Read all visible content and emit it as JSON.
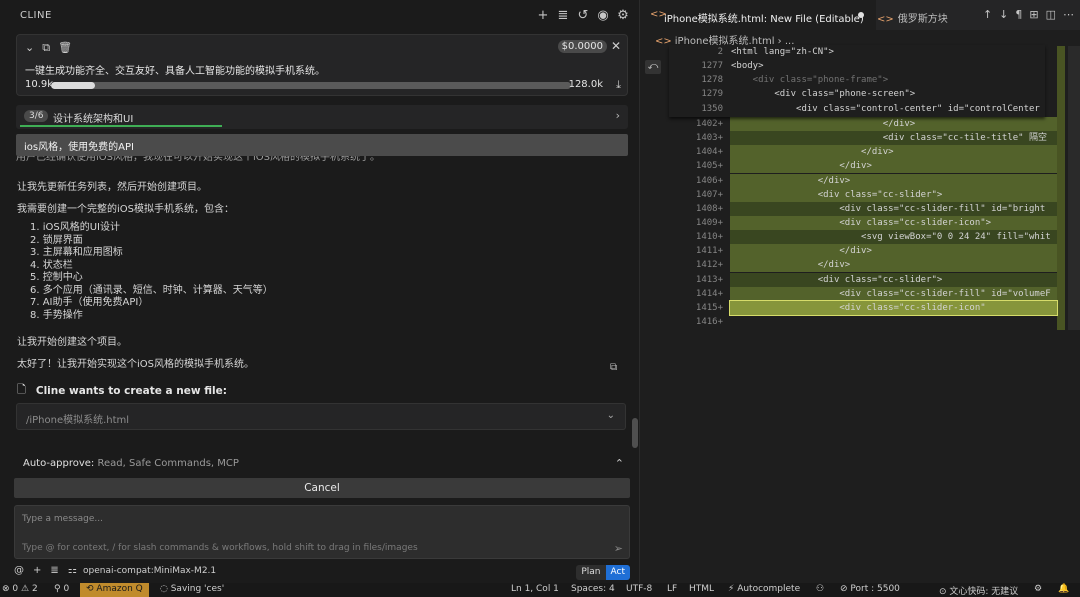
{
  "cline": {
    "title": "CLINE",
    "header_icons": [
      "+",
      "≣",
      "↺",
      "◉",
      "⚙"
    ],
    "task": {
      "cost": "$0.0000",
      "text": "一键生成功能齐全、交互友好、具备人工智能功能的模拟手机系统。",
      "context_used": "10.9k",
      "context_max": "128.0k",
      "context_fraction": 0.085
    },
    "step": {
      "badge": "3/6",
      "label": "设计系统架构和UI",
      "progress_fraction": 0.33
    },
    "tooltip": "ios风格，使用免费的API",
    "cut_line": "用户已经确认使用iOS风格，我现在可以开始实现这个iOS风格的模拟手机系统了。",
    "messages": {
      "m1": "让我先更新任务列表，然后开始创建项目。",
      "m2": "我需要创建一个完整的iOS模拟手机系统，包含：",
      "list": [
        "1. iOS风格的UI设计",
        "2. 锁屏界面",
        "3. 主屏幕和应用图标",
        "4. 状态栏",
        "5. 控制中心",
        "6. 多个应用（通讯录、短信、时钟、计算器、天气等）",
        "7. AI助手（使用免费API）",
        "8. 手势操作"
      ],
      "m3": "让我开始创建这个项目。",
      "m4": "太好了！让我开始实现这个iOS风格的模拟手机系统。"
    },
    "create": {
      "title": "Cline wants to create a new file:",
      "file": "/iPhone模拟系统.html"
    },
    "auto_approve": {
      "label": "Auto-approve:",
      "value": "Read, Safe Commands, MCP"
    },
    "cancel_label": "Cancel",
    "input": {
      "placeholder": "Type a message...",
      "hint": "Type @ for context, / for slash commands & workflows, hold shift to drag in files/images"
    },
    "footer": {
      "model": "openai-compat:MiniMax-M2.1",
      "plan": "Plan",
      "act": "Act"
    }
  },
  "editor": {
    "tab_active": "iPhone模拟系统.html: New File (Editable)",
    "tab2": "俄罗斯方块",
    "breadcrumb": "iPhone模拟系统.html",
    "breadcrumb_more": "...",
    "sticky": [
      {
        "ln": "2",
        "code": "<html lang=\"zh-CN\">"
      },
      {
        "ln": "1277",
        "code": "<body>"
      },
      {
        "ln": "1278",
        "code": "    <div class=\"phone-frame\">"
      },
      {
        "ln": "1279",
        "code": "        <div class=\"phone-screen\">"
      },
      {
        "ln": "1350",
        "code": "            <div class=\"control-center\" id=\"controlCenter"
      }
    ],
    "lines": [
      {
        "ln": "1402+",
        "code": "                            </div>"
      },
      {
        "ln": "1403+",
        "code": "                            <div class=\"cc-tile-title\" 隔空"
      },
      {
        "ln": "1404+",
        "code": "                        </div>"
      },
      {
        "ln": "1405+",
        "code": "                    </div>"
      },
      {
        "ln": "1406+",
        "code": "                </div>"
      },
      {
        "ln": "1407+",
        "code": "                <div class=\"cc-slider\">"
      },
      {
        "ln": "1408+",
        "code": "                    <div class=\"cc-slider-fill\" id=\"bright"
      },
      {
        "ln": "1409+",
        "code": "                    <div class=\"cc-slider-icon\">"
      },
      {
        "ln": "1410+",
        "code": "                        <svg viewBox=\"0 0 24 24\" fill=\"whit"
      },
      {
        "ln": "1411+",
        "code": "                    </div>"
      },
      {
        "ln": "1412+",
        "code": "                </div>"
      },
      {
        "ln": "1413+",
        "code": "                <div class=\"cc-slider\">"
      },
      {
        "ln": "1414+",
        "code": "                    <div class=\"cc-slider-fill\" id=\"volumeF"
      },
      {
        "ln": "1415+",
        "code": "                    <div class=\"cc-slider-icon\""
      },
      {
        "ln": "1416+",
        "code": ""
      }
    ]
  },
  "status": {
    "errors": "0",
    "warnings": "2",
    "ports": "0",
    "amazon": "Amazon Q",
    "saving": "Saving 'ces'",
    "position": "Ln 1, Col 1",
    "spaces": "Spaces: 4",
    "encoding": "UTF-8",
    "eol": "LF",
    "lang": "HTML",
    "autocomplete": "Autocomplete",
    "port": "Port : 5500",
    "wenxin": "文心快码: 无建议"
  }
}
